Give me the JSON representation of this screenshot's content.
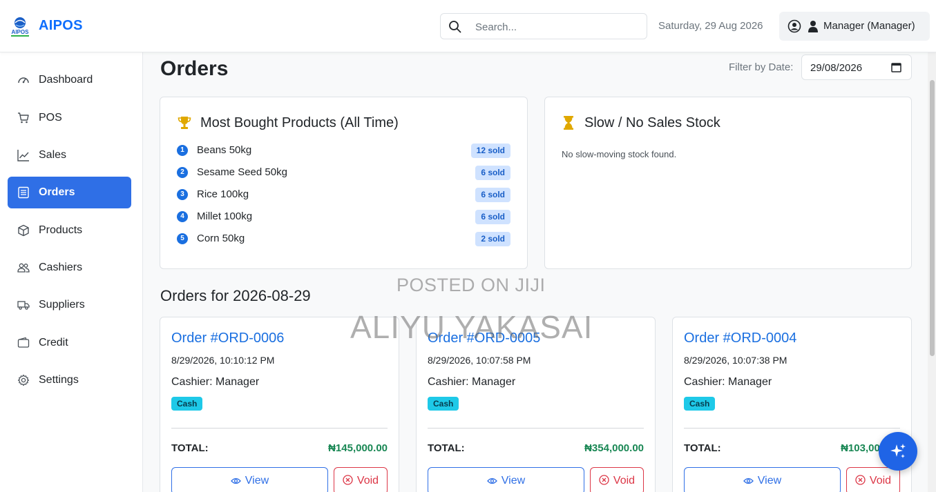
{
  "header": {
    "brand": "AIPOS",
    "logo_text": "AIPOS",
    "search_placeholder": "Search...",
    "date": "Saturday, 29 Aug 2026",
    "user_label": "Manager (Manager)"
  },
  "sidebar": {
    "items": [
      {
        "label": "Dashboard",
        "icon": "speedometer-icon"
      },
      {
        "label": "POS",
        "icon": "cart-icon"
      },
      {
        "label": "Sales",
        "icon": "chart-line-icon"
      },
      {
        "label": "Orders",
        "icon": "list-icon",
        "active": true
      },
      {
        "label": "Products",
        "icon": "box-icon"
      },
      {
        "label": "Cashiers",
        "icon": "people-icon"
      },
      {
        "label": "Suppliers",
        "icon": "truck-icon"
      },
      {
        "label": "Credit",
        "icon": "wallet-icon"
      },
      {
        "label": "Settings",
        "icon": "gear-icon"
      }
    ]
  },
  "main": {
    "title": "Orders",
    "filter_label": "Filter by Date:",
    "filter_value": "29/08/2026",
    "most_bought": {
      "title": "Most Bought Products (All Time)",
      "items": [
        {
          "rank": "1",
          "name": "Beans 50kg",
          "sold": "12 sold"
        },
        {
          "rank": "2",
          "name": "Sesame Seed 50kg",
          "sold": "6 sold"
        },
        {
          "rank": "3",
          "name": "Rice 100kg",
          "sold": "6 sold"
        },
        {
          "rank": "4",
          "name": "Millet 100kg",
          "sold": "6 sold"
        },
        {
          "rank": "5",
          "name": "Corn 50kg",
          "sold": "2 sold"
        }
      ]
    },
    "slow_stock": {
      "title": "Slow / No Sales Stock",
      "empty_text": "No slow-moving stock found."
    },
    "orders_title": "Orders for 2026-08-29",
    "orders": [
      {
        "title": "Order #ORD-0006",
        "time": "8/29/2026, 10:10:12 PM",
        "cashier": "Cashier: Manager",
        "payment": "Cash",
        "total_label": "TOTAL:",
        "total": "₦145,000.00",
        "view_label": "View",
        "void_label": "Void"
      },
      {
        "title": "Order #ORD-0005",
        "time": "8/29/2026, 10:07:58 PM",
        "cashier": "Cashier: Manager",
        "payment": "Cash",
        "total_label": "TOTAL:",
        "total": "₦354,000.00",
        "view_label": "View",
        "void_label": "Void"
      },
      {
        "title": "Order #ORD-0004",
        "time": "8/29/2026, 10:07:38 PM",
        "cashier": "Cashier: Manager",
        "payment": "Cash",
        "total_label": "TOTAL:",
        "total": "₦103,000.00",
        "view_label": "View",
        "void_label": "Void"
      }
    ]
  },
  "watermark": {
    "line1": "POSTED ON JIJI",
    "line2": "ALIYU YAKASAI"
  },
  "colors": {
    "primary": "#2f6fe6",
    "success": "#198754",
    "danger": "#dc3545",
    "info_badge": "#1ec9e8",
    "sold_badge": "#cfe2ff"
  }
}
